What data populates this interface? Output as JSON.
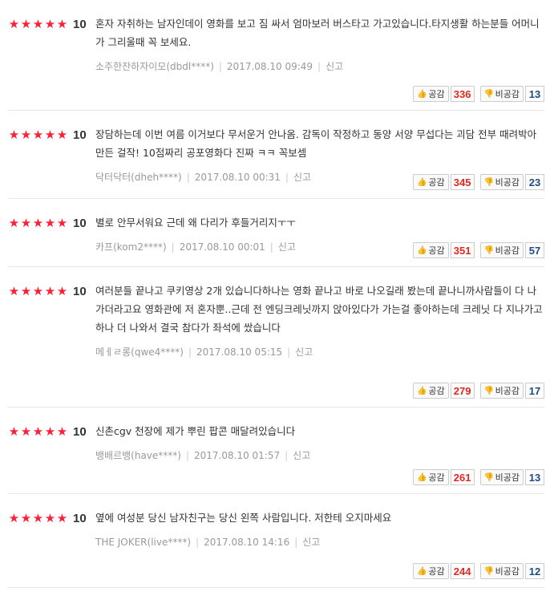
{
  "labels": {
    "like": "공감",
    "dislike": "비공감",
    "report": "신고"
  },
  "icons": {
    "star": "star-icon",
    "like": "thumbs-up-icon",
    "dislike": "thumbs-down-icon"
  },
  "colors": {
    "star": "#ff1f36",
    "like_count": "#e1271e",
    "dislike_count": "#1e4a84"
  },
  "reviews": [
    {
      "stars": 5,
      "score": "10",
      "text": "혼자 자취하는 남자인데이 영화를 보고 짐 싸서 엄마보러 버스타고 가고있습니다.타지생활 하는분들 어머니가 그리울때 꼭 보세요.",
      "author": "소주한잔하자이모(dbdl****)",
      "date": "2017.08.10 09:49",
      "likes": "336",
      "dislikes": "13"
    },
    {
      "stars": 5,
      "score": "10",
      "text": "장담하는데 이번 여름 이거보다 무서운거 안나옴. 감독이 작정하고 동양 서양 무섭다는 괴담 전부 때려박아 만든 걸작! 10점짜리 공포영화다 진짜 ㅋㅋ 꼭보셈",
      "author": "닥터닥터(dheh****)",
      "date": "2017.08.10 00:31",
      "likes": "345",
      "dislikes": "23"
    },
    {
      "stars": 5,
      "score": "10",
      "text": "별로 안무서워요 근데 왜 다리가 후들거리지ㅜㅜ",
      "author": "카프(kom2****)",
      "date": "2017.08.10 00:01",
      "likes": "351",
      "dislikes": "57"
    },
    {
      "stars": 5,
      "score": "10",
      "text": "여러분들 끝나고 쿠키영상 2개 있습니다하나는 영화 끝나고 바로 나오길래 봤는데 끝나니까사람들이 다 나가더라고요 영화관에 저 혼자뿐..근데 전 엔딩크레닛까지 앉아있다가 가는걸 좋아하는데 크레닛 다 지나가고 하나 더 나와서 결국 참다가 좌석에 쌌습니다",
      "author": "메ㅔㄹ롱(qwe4****)",
      "date": "2017.08.10 05:15",
      "likes": "279",
      "dislikes": "17"
    },
    {
      "stars": 5,
      "score": "10",
      "text": "신촌cgv 천장에 제가 뿌린 팝콘 매달려있습니다",
      "author": "뱅배르뱅(have****)",
      "date": "2017.08.10 01:57",
      "likes": "261",
      "dislikes": "13"
    },
    {
      "stars": 5,
      "score": "10",
      "text": "옆에 여성분 당신 남자친구는 당신 왼쪽 사람입니다. 저한테 오지마세요",
      "author": "THE JOKER(live****)",
      "date": "2017.08.10 14:16",
      "likes": "244",
      "dislikes": "12"
    }
  ]
}
